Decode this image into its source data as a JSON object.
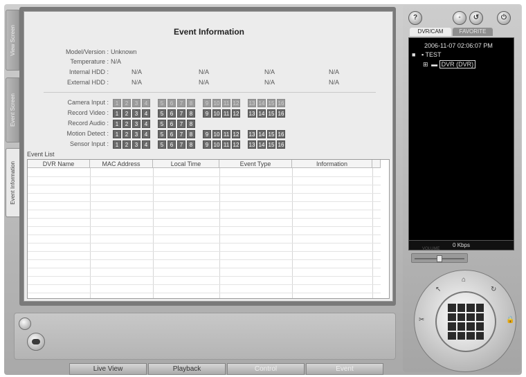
{
  "left_tabs": [
    {
      "label": "View Screen",
      "active": false
    },
    {
      "label": "Event Screen",
      "active": false
    },
    {
      "label": "Event Information",
      "active": true
    }
  ],
  "event_info": {
    "title": "Event Information",
    "model_version_label": "Model/Version :",
    "model_version_value": "Unknown",
    "temperature_label": "Temperature :",
    "temperature_value": "N/A",
    "internal_hdd_label": "Internal HDD :",
    "internal_hdd_values": [
      "N/A",
      "N/A",
      "N/A",
      "N/A"
    ],
    "external_hdd_label": "External HDD :",
    "external_hdd_values": [
      "N/A",
      "N/A",
      "N/A",
      "N/A"
    ]
  },
  "channel_rows": [
    {
      "label": "Camera Input :",
      "count": 16,
      "dim": true
    },
    {
      "label": "Record Video :",
      "count": 16,
      "dim": false
    },
    {
      "label": "Record Audio :",
      "count": 8,
      "dim": false
    },
    {
      "label": "Motion Detect :",
      "count": 16,
      "dim": false
    },
    {
      "label": "Sensor Input :",
      "count": 16,
      "dim": false
    }
  ],
  "event_list": {
    "label": "Event List",
    "columns": [
      "DVR Name",
      "MAC Address",
      "Local Time",
      "Event Type",
      "Information"
    ],
    "rows": []
  },
  "bottom_tabs": [
    {
      "label": "Live View",
      "faded": false
    },
    {
      "label": "Playback",
      "faded": false
    },
    {
      "label": "Control",
      "faded": true
    },
    {
      "label": "Event",
      "faded": true
    }
  ],
  "right_panel": {
    "tabs": [
      "DVR/CAM",
      "FAVORITE"
    ],
    "datetime": "2006-11-07 02:06:07 PM",
    "tree": [
      {
        "label": "TEST",
        "level": 0
      },
      {
        "label": "DVR (DVR)",
        "level": 1,
        "selected": true
      }
    ],
    "bitrate": "0 Kbps",
    "volume_label": "VOLUME",
    "volume_level": 0.5
  },
  "colors": {
    "channel_on": "#6a6a6a",
    "channel_dim": "#9b9b9b",
    "tree_bg": "#000000"
  }
}
